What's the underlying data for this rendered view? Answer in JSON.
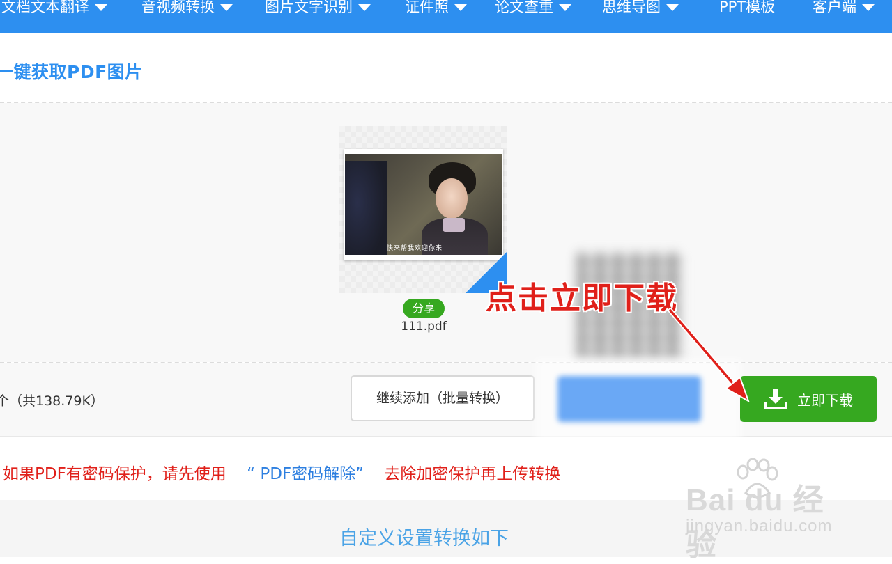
{
  "nav": {
    "items": [
      {
        "label": "文档文本翻译",
        "has_dropdown": true
      },
      {
        "label": "音视频转换",
        "has_dropdown": true
      },
      {
        "label": "图片文字识别",
        "has_dropdown": true
      },
      {
        "label": "证件照",
        "has_dropdown": true
      },
      {
        "label": "论文查重",
        "has_dropdown": true
      },
      {
        "label": "思维导图",
        "has_dropdown": true
      },
      {
        "label": "PPT模板",
        "has_dropdown": false
      },
      {
        "label": "客户端",
        "has_dropdown": true
      }
    ]
  },
  "page": {
    "title": "一键获取PDF图片"
  },
  "file": {
    "name": "111.pdf",
    "share_label": "分享",
    "thumbnail_caption": "快来帮我欢迎你来"
  },
  "actions": {
    "summary": "个（共138.79K）",
    "add_more_label": "继续添加（批量转换）",
    "download_label": "立即下载"
  },
  "notice": {
    "part1": "如果PDF有密码保护，请先使用",
    "link": "“ PDF密码解除”",
    "part2": "去除加密保护再上传转换"
  },
  "settings": {
    "label": "自定义设置转换如下"
  },
  "annotation": {
    "text": "点击立即下载",
    "color": "#e0201a"
  },
  "watermark": {
    "logo": "Bai du 经验",
    "sub": "jingyan.baidu.com"
  },
  "colors": {
    "brand_blue": "#2d8ff0",
    "download_green": "#36a820",
    "warning_red": "#e0201a"
  }
}
